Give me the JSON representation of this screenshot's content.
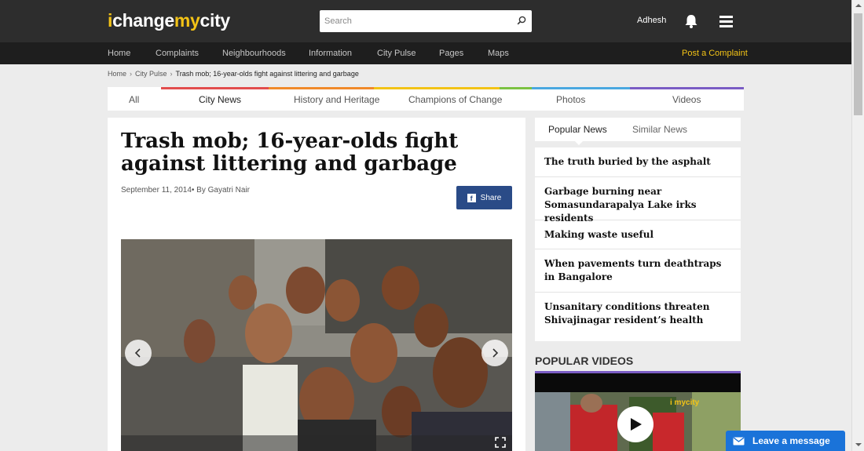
{
  "header": {
    "logo": {
      "part1": "i",
      "part2": "change",
      "part3": "my",
      "part4": "city"
    },
    "search_placeholder": "Search",
    "username": "Adhesh"
  },
  "nav": {
    "items": [
      "Home",
      "Complaints",
      "Neighbourhoods",
      "Information",
      "City Pulse",
      "Pages",
      "Maps"
    ],
    "post_complaint": "Post a Complaint"
  },
  "breadcrumb": {
    "items": [
      "Home",
      "City Pulse"
    ],
    "separator": "›",
    "current": "Trash mob; 16-year-olds fight against littering and garbage"
  },
  "categories": {
    "items": [
      "All",
      "City News",
      "History and Heritage",
      "Champions of Change",
      "Photos",
      "Videos"
    ],
    "active": "City News",
    "stripe_colors": [
      "#e24d4d",
      "#f08a2a",
      "#f3c316",
      "#7cc242",
      "#4aa8e0",
      "#7a5cc4"
    ]
  },
  "article": {
    "title": "Trash mob; 16-year-olds fight against littering and garbage",
    "date": "September 11, 2014",
    "author_prefix": "• By ",
    "author": "Gayatri Nair",
    "share_label": "Share",
    "share_icon": "facebook-icon"
  },
  "sidebar": {
    "tabs": [
      "Popular News",
      "Similar News"
    ],
    "active_tab": "Popular News",
    "news": [
      "The truth buried by the asphalt",
      "Garbage burning near Somasundarapalya Lake irks residents",
      "Making waste useful",
      "When pavements turn deathtraps in Bangalore",
      "Unsanitary conditions threaten Shivajinagar resident’s health"
    ],
    "popular_videos_title": "POPULAR VIDEOS",
    "video_watermark": "i          mycity"
  },
  "chat": {
    "label": "Leave a message"
  },
  "colors": {
    "topbar": "#2d2d2d",
    "navbar": "#1e1e1e",
    "accent_yellow": "#f3c316",
    "share_blue": "#2a4b87",
    "chat_blue": "#1a73d9"
  }
}
